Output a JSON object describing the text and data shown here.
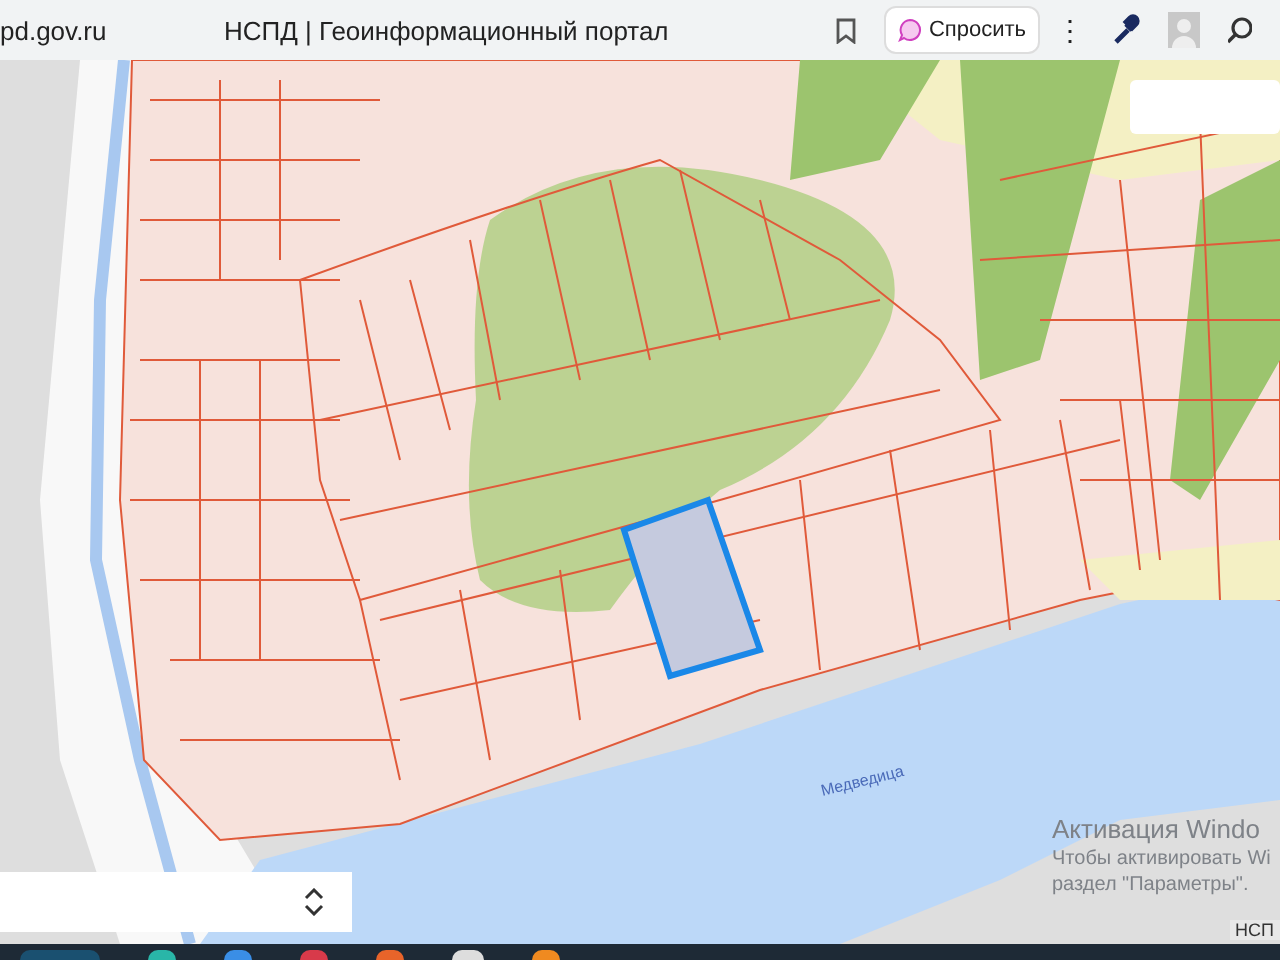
{
  "browser": {
    "url": "pd.gov.ru",
    "tab_title": "НСПД | Геоинформационный портал",
    "ask_button": "Спросить",
    "menu_glyph": "⋮"
  },
  "map": {
    "river_label": "Медведица",
    "attribution": "НСП"
  },
  "activation": {
    "title": "Активация Windo",
    "line1": "Чтобы активировать Wi",
    "line2": "раздел \"Параметры\"."
  }
}
